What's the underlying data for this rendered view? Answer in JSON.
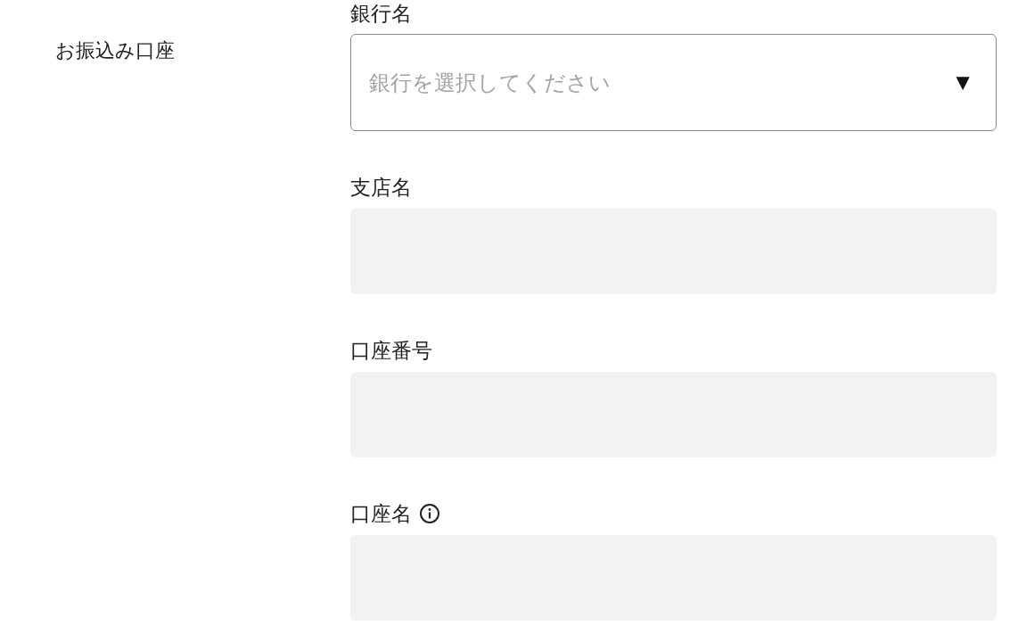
{
  "section_label": "お振込み口座",
  "fields": [
    {
      "kind": "select",
      "label": "銀行名",
      "placeholder": "銀行を選択してください",
      "arrow": "▼",
      "disabled": false,
      "info": false
    },
    {
      "kind": "text",
      "label": "支店名",
      "disabled": true,
      "info": false
    },
    {
      "kind": "text",
      "label": "口座番号",
      "disabled": true,
      "info": false
    },
    {
      "kind": "text",
      "label": "口座名",
      "disabled": true,
      "info": true
    }
  ]
}
